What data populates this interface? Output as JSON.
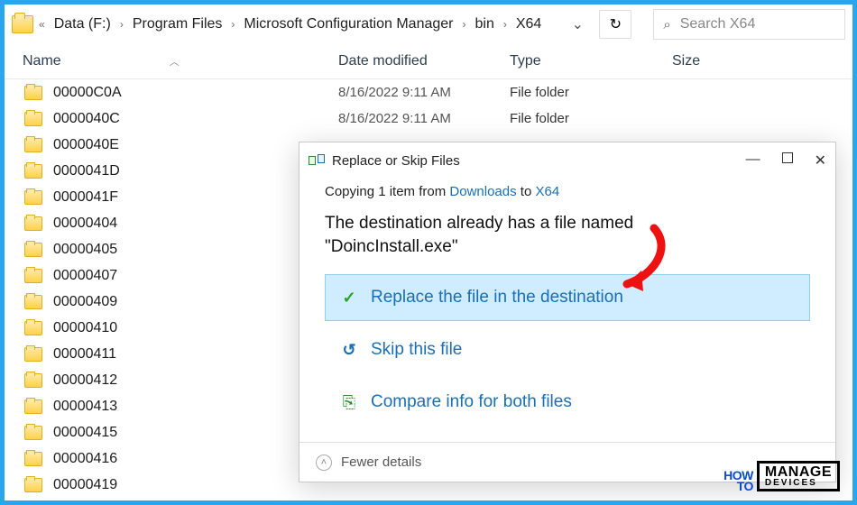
{
  "breadcrumb": {
    "root": "Data (F:)",
    "p1": "Program Files",
    "p2": "Microsoft Configuration Manager",
    "p3": "bin",
    "p4": "X64"
  },
  "search": {
    "placeholder": "Search X64"
  },
  "columns": {
    "name": "Name",
    "date": "Date modified",
    "type": "Type",
    "size": "Size"
  },
  "rows": [
    {
      "name": "00000C0A",
      "date": "8/16/2022 9:11 AM",
      "type": "File folder"
    },
    {
      "name": "0000040C",
      "date": "8/16/2022 9:11 AM",
      "type": "File folder"
    },
    {
      "name": "0000040E",
      "date": "",
      "type": ""
    },
    {
      "name": "0000041D",
      "date": "",
      "type": ""
    },
    {
      "name": "0000041F",
      "date": "",
      "type": ""
    },
    {
      "name": "00000404",
      "date": "",
      "type": ""
    },
    {
      "name": "00000405",
      "date": "",
      "type": ""
    },
    {
      "name": "00000407",
      "date": "",
      "type": ""
    },
    {
      "name": "00000409",
      "date": "",
      "type": ""
    },
    {
      "name": "00000410",
      "date": "",
      "type": ""
    },
    {
      "name": "00000411",
      "date": "",
      "type": ""
    },
    {
      "name": "00000412",
      "date": "",
      "type": ""
    },
    {
      "name": "00000413",
      "date": "",
      "type": ""
    },
    {
      "name": "00000415",
      "date": "",
      "type": ""
    },
    {
      "name": "00000416",
      "date": "",
      "type": ""
    },
    {
      "name": "00000419",
      "date": "",
      "type": ""
    }
  ],
  "dialog": {
    "title": "Replace or Skip Files",
    "copy_prefix": "Copying 1 item from ",
    "copy_src": "Downloads",
    "copy_mid": " to ",
    "copy_dst": "X64",
    "msg_l1": "The destination already has a file named",
    "msg_l2": "\"DoincInstall.exe\"",
    "opt_replace": "Replace the file in the destination",
    "opt_skip": "Skip this file",
    "opt_compare": "Compare info for both files",
    "fewer": "Fewer details"
  },
  "watermark": {
    "how": "HOW",
    "to": "TO",
    "manage": "MANAGE",
    "devices": "DEVICES"
  }
}
